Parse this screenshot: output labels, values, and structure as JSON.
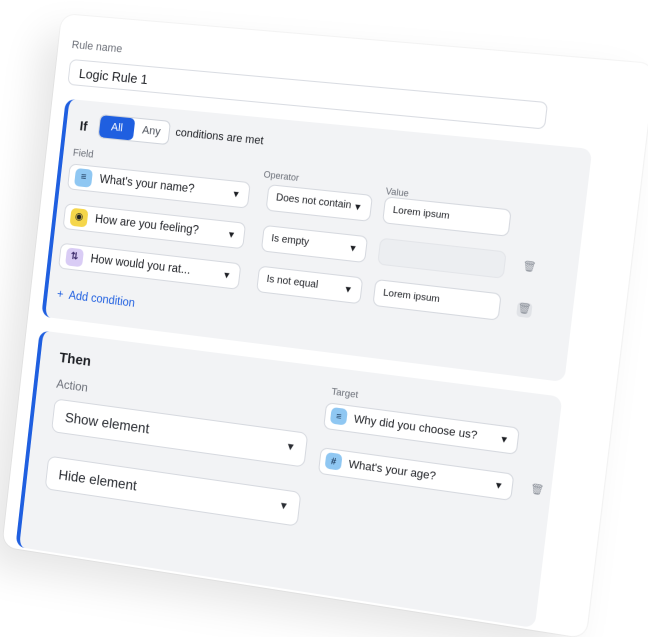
{
  "rule": {
    "name_label": "Rule name",
    "name_value": "Logic Rule 1"
  },
  "if_section": {
    "if_label": "If",
    "match_options": [
      "All",
      "Any"
    ],
    "match_selected": "All",
    "conditions_text": "conditions are met",
    "field_label": "Field",
    "operator_label": "Operator",
    "value_label": "Value",
    "conditions": [
      {
        "field": "What's your name?",
        "field_icon": "text-icon",
        "operator": "Does not contain",
        "value": "Lorem ipsum",
        "has_delete": false
      },
      {
        "field": "How are you feeling?",
        "field_icon": "eye-icon",
        "operator": "Is empty",
        "value": "",
        "has_delete": true
      },
      {
        "field": "How would you rat...",
        "field_icon": "sort-icon",
        "operator": "Is not equal",
        "value": "Lorem ipsum",
        "has_delete": true
      }
    ],
    "add_condition": "Add condition",
    "add_icon": "+"
  },
  "then_section": {
    "title": "Then",
    "action_label": "Action",
    "target_label": "Target",
    "actions": [
      {
        "action": "Show element",
        "target": "Why did you choose us?",
        "target_icon": "text-icon",
        "icon_glyph": "≡"
      },
      {
        "action": "Hide element",
        "target": "What's your age?",
        "target_icon": "hash-icon",
        "icon_glyph": "#"
      }
    ]
  },
  "colors": {
    "accent": "#1f5fe0",
    "panel": "#f2f3f5",
    "icon_text": "#8fc7f2",
    "icon_eye": "#f5d64a",
    "icon_sort": "#d9ccf5"
  }
}
